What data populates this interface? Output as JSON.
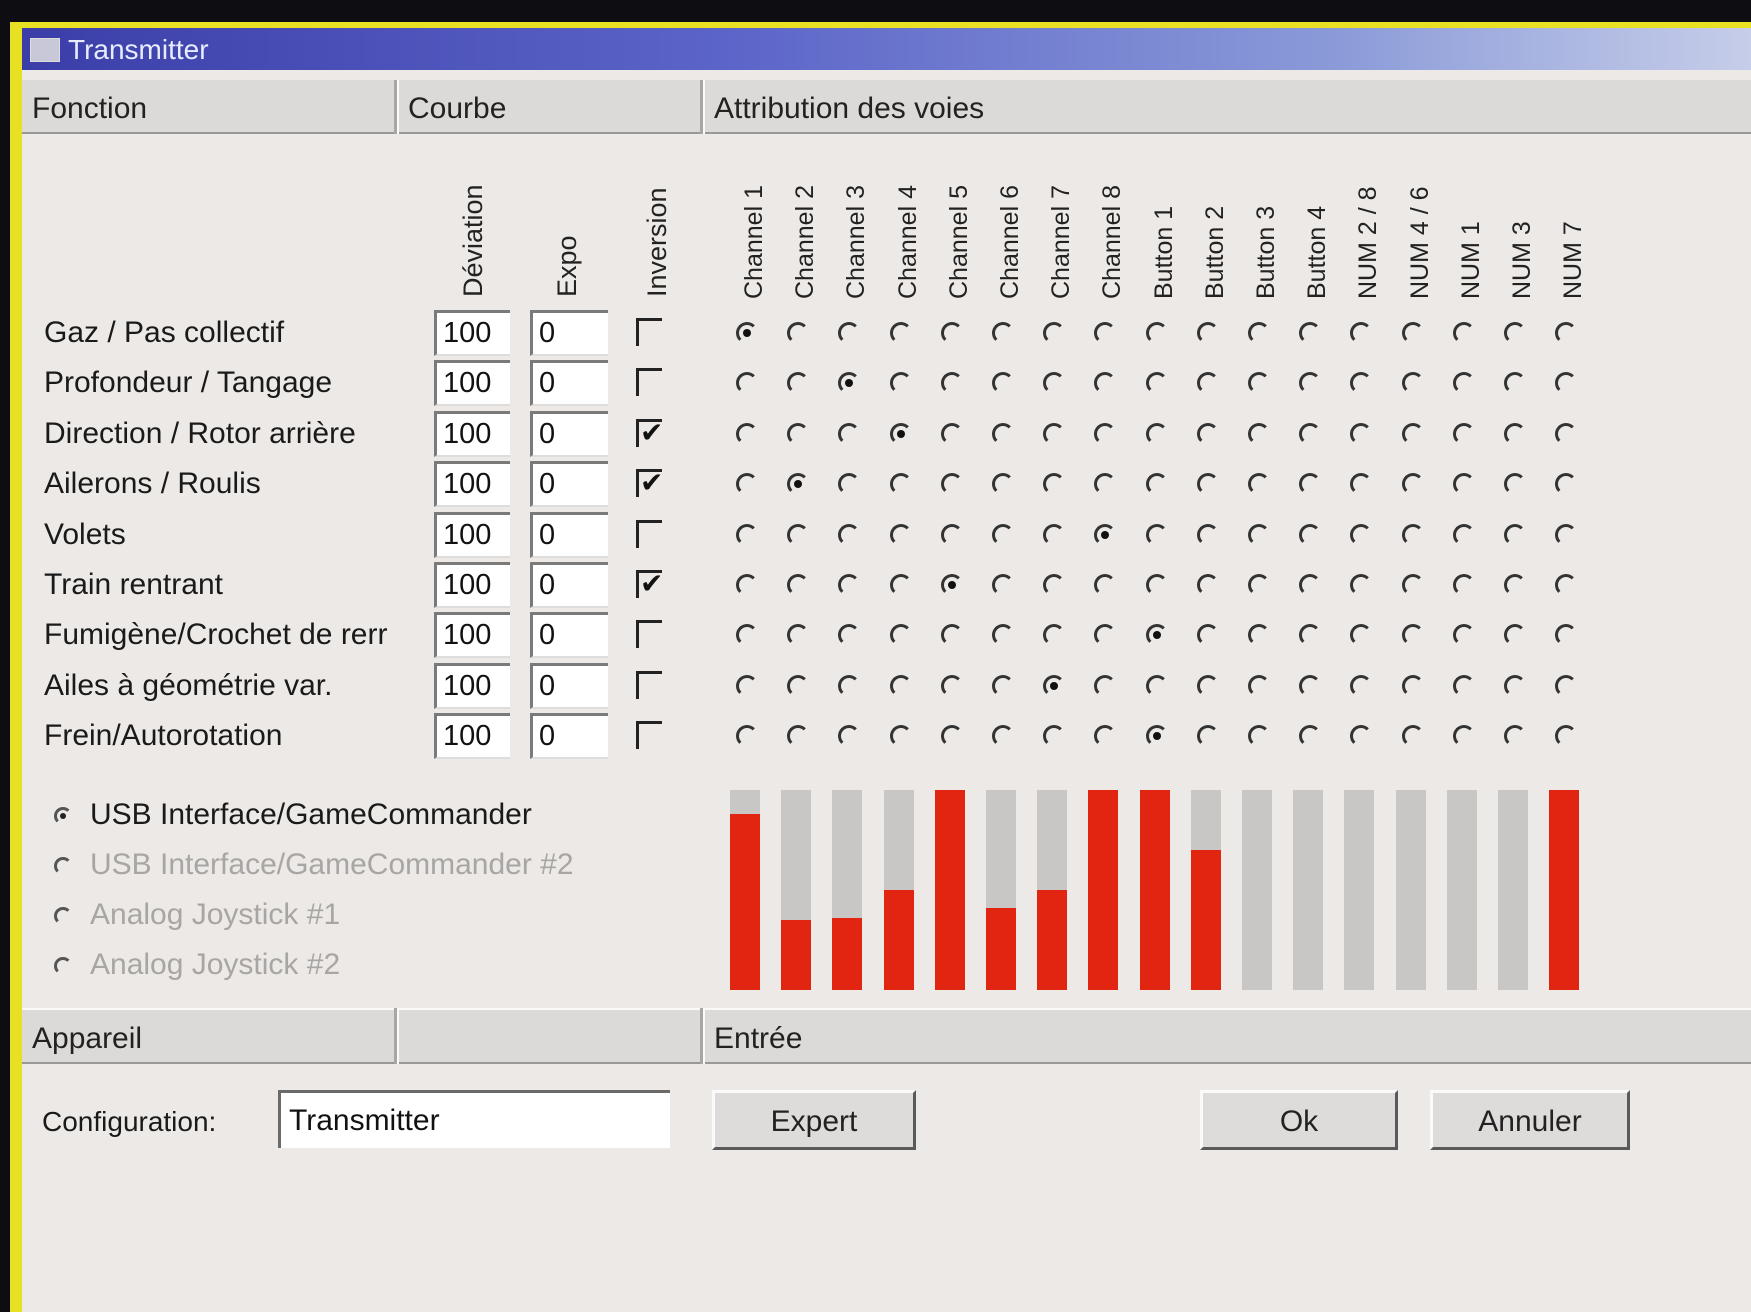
{
  "window": {
    "title": "Transmitter"
  },
  "headers": {
    "fonction": "Fonction",
    "courbe": "Courbe",
    "attribution": "Attribution des voies",
    "appareil": "Appareil",
    "entree": "Entrée"
  },
  "columns": {
    "deviation": "Déviation",
    "expo": "Expo",
    "inversion": "Inversion"
  },
  "channels": [
    "Channel 1",
    "Channel 2",
    "Channel 3",
    "Channel 4",
    "Channel 5",
    "Channel 6",
    "Channel 7",
    "Channel 8",
    "Button 1",
    "Button 2",
    "Button 3",
    "Button 4",
    "NUM 2 / 8",
    "NUM 4 / 6",
    "NUM 1",
    "NUM 3",
    "NUM 7"
  ],
  "functions": [
    {
      "label": "Gaz / Pas collectif",
      "deviation": "100",
      "expo": "0",
      "inversion": false,
      "channel": 0
    },
    {
      "label": "Profondeur / Tangage",
      "deviation": "100",
      "expo": "0",
      "inversion": false,
      "channel": 2
    },
    {
      "label": "Direction / Rotor arrière",
      "deviation": "100",
      "expo": "0",
      "inversion": true,
      "channel": 3
    },
    {
      "label": "Ailerons / Roulis",
      "deviation": "100",
      "expo": "0",
      "inversion": true,
      "channel": 1
    },
    {
      "label": "Volets",
      "deviation": "100",
      "expo": "0",
      "inversion": false,
      "channel": 7
    },
    {
      "label": "Train rentrant",
      "deviation": "100",
      "expo": "0",
      "inversion": true,
      "channel": 4
    },
    {
      "label": "Fumigène/Crochet de rerr",
      "deviation": "100",
      "expo": "0",
      "inversion": false,
      "channel": 8
    },
    {
      "label": "Ailes à géométrie var.",
      "deviation": "100",
      "expo": "0",
      "inversion": false,
      "channel": 6
    },
    {
      "label": "Frein/Autorotation",
      "deviation": "100",
      "expo": "0",
      "inversion": false,
      "channel": 8
    }
  ],
  "inputs": [
    {
      "name": "Channel 1",
      "level": 0.88
    },
    {
      "name": "Channel 2",
      "level": 0.35
    },
    {
      "name": "Channel 3",
      "level": 0.36
    },
    {
      "name": "Channel 4",
      "level": 0.5
    },
    {
      "name": "Channel 5",
      "level": 1.0
    },
    {
      "name": "Channel 6",
      "level": 0.41
    },
    {
      "name": "Channel 7",
      "level": 0.5
    },
    {
      "name": "Channel 8",
      "level": 1.0
    },
    {
      "name": "Button 1",
      "level": 1.0
    },
    {
      "name": "Button 2",
      "level": 0.7
    },
    {
      "name": "Button 3",
      "level": 0
    },
    {
      "name": "Button 4",
      "level": 0
    },
    {
      "name": "NUM 2 / 8",
      "level": 0
    },
    {
      "name": "NUM 4 / 6",
      "level": 0
    },
    {
      "name": "NUM 1",
      "level": 0
    },
    {
      "name": "NUM 3",
      "level": 0
    },
    {
      "name": "NUM 7",
      "level": 1.0
    }
  ],
  "devices": [
    {
      "label": "USB Interface/GameCommander",
      "selected": true,
      "enabled": true
    },
    {
      "label": "USB Interface/GameCommander #2",
      "selected": false,
      "enabled": false
    },
    {
      "label": "Analog Joystick #1",
      "selected": false,
      "enabled": false
    },
    {
      "label": "Analog Joystick #2",
      "selected": false,
      "enabled": false
    }
  ],
  "config": {
    "label": "Configuration:",
    "value": "Transmitter"
  },
  "buttons": {
    "expert": "Expert",
    "ok": "Ok",
    "cancel": "Annuler"
  },
  "colors": {
    "bar_fill": "#e22510",
    "bar_track": "#c9c7c5",
    "title_bar": "#3b3ea8"
  }
}
